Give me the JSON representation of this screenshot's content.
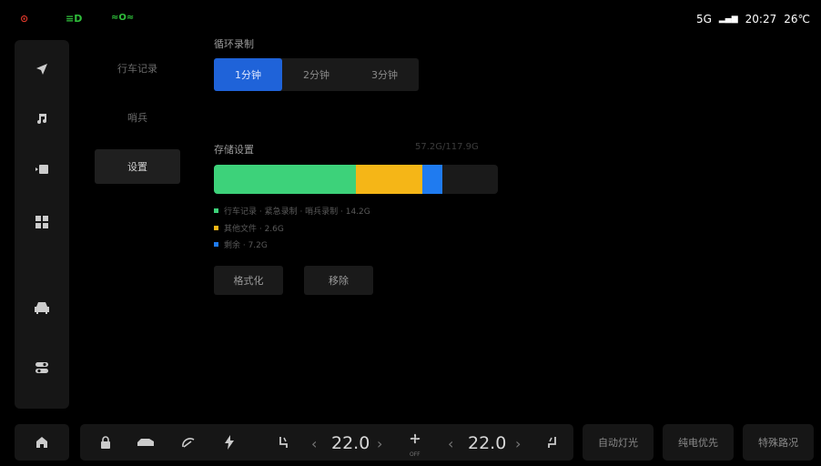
{
  "status_bar": {
    "icon1": "warning-circle-icon",
    "icon2": "low-beam-icon",
    "icon3": "position-light-icon",
    "network": "5G",
    "time": "20:27",
    "temperature": "26℃"
  },
  "sidebar": {
    "items": [
      {
        "name": "navigation-icon"
      },
      {
        "name": "music-icon"
      },
      {
        "name": "camera-icon"
      },
      {
        "name": "apps-grid-icon"
      },
      {
        "name": "car-icon"
      },
      {
        "name": "toggle-settings-icon"
      }
    ]
  },
  "subnav": {
    "items": [
      {
        "label": "行车记录"
      },
      {
        "label": "哨兵"
      },
      {
        "label": "设置"
      }
    ]
  },
  "loop_recording": {
    "label": "循环录制",
    "options": [
      "1分钟",
      "2分钟",
      "3分钟"
    ],
    "selected": "1分钟"
  },
  "storage": {
    "label": "存储设置",
    "summary": "57.2G/117.9G",
    "segments": [
      {
        "name": "green",
        "color": "#3dd27a",
        "fraction": 0.5
      },
      {
        "name": "yellow",
        "color": "#f5b617",
        "fraction": 0.235
      },
      {
        "name": "blue",
        "color": "#1f7bf0",
        "fraction": 0.07
      }
    ],
    "legend": [
      {
        "text": "行车记录 · 紧急录制 · 哨兵录制 · 14.2G",
        "color": "#3dd27a"
      },
      {
        "text": "其他文件 · 2.6G",
        "color": "#f5b617"
      },
      {
        "text": "剩余 · 7.2G",
        "color": "#1f7bf0"
      }
    ],
    "format_label": "格式化",
    "delete_label": "移除"
  },
  "dock": {
    "home_icon": "home-icon",
    "left_temp": "22.0",
    "right_temp": "22.0",
    "fan_label": "OFF",
    "quick1": "自动灯光",
    "quick2": "纯电优先",
    "quick3": "特殊路况"
  }
}
